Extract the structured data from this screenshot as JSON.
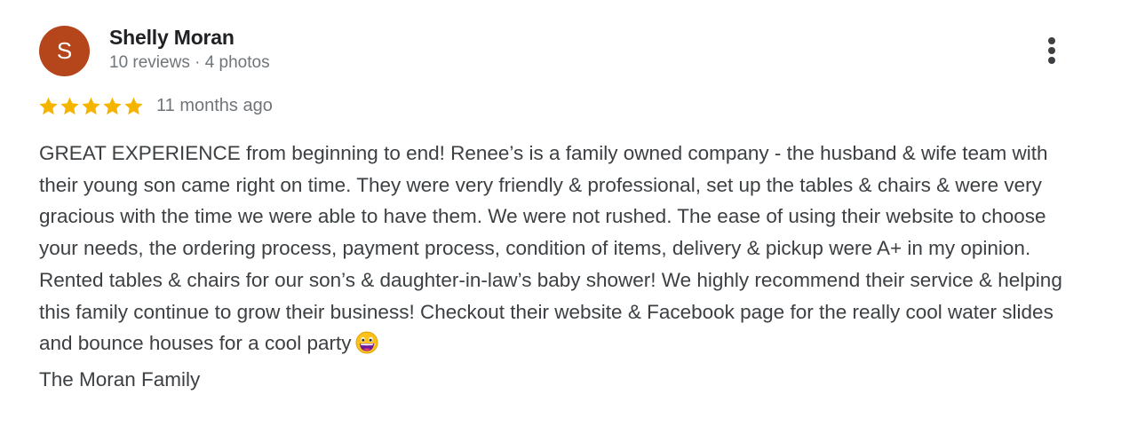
{
  "reviewer": {
    "initial": "S",
    "name": "Shelly Moran",
    "meta": "10 reviews · 4 photos",
    "avatar_color": "#b5451b"
  },
  "rating": {
    "stars": 5,
    "max_stars": 5,
    "star_color": "#f4b400",
    "time_ago": "11 months ago"
  },
  "review": {
    "line_1": "GREAT EXPERIENCE from beginning to end! Renee’s is a family owned company - the husband & wife team with their young son came right on time. They were very friendly & professional, set up the tables & chairs & were very gracious with the time we were able to have them. We were not rushed. The ease of using their website to choose your needs, the ordering process, payment process, condition of items, delivery & pickup were A+ in my opinion. Rented tables & chairs for our son’s & daughter-in-law’s baby shower! We highly recommend their service & helping this family continue to grow their business! Checkout their website & Facebook page for the really cool water slides and bounce houses for a cool party",
    "emoji": "grinning-face-emoji",
    "signature": "The Moran Family"
  },
  "actions": {
    "more_icon": "more-vert-icon"
  }
}
